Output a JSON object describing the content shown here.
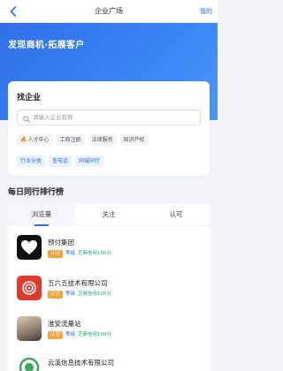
{
  "header": {
    "title": "企业广场",
    "mine_label": "我的"
  },
  "hero": {
    "slogan": "发现商机·拓展客户"
  },
  "find": {
    "title": "找企业",
    "search_placeholder": "请输入企业名称",
    "chips_row1": [
      "人才中心",
      "工商注册",
      "法律服务",
      "知识产权"
    ],
    "chips_row2": [
      "行业分类",
      "查电话",
      "同城同行"
    ]
  },
  "ranking": {
    "title": "每日同行排行榜",
    "tabs": [
      "浏览量",
      "关注",
      "认可"
    ],
    "items": [
      {
        "name": "预付集团",
        "badge_verified": "认证",
        "badge_level": "等级",
        "badge_credit": "芝麻信用100分"
      },
      {
        "name": "五六五技术有限公司",
        "badge_verified": "认证",
        "badge_level": "等级",
        "badge_credit": "芝麻信用100分"
      },
      {
        "name": "淮安流量站",
        "badge_verified": "认证",
        "badge_level": "等级",
        "badge_credit": "芝麻信用100分"
      },
      {
        "name": "云溪信息技术有限公司",
        "badge_verified": "认证",
        "badge_level": "等级",
        "badge_credit": "芝麻信用100分"
      }
    ]
  },
  "colors": {
    "brand_blue": "#2f6fe4",
    "orange": "#f7a23a",
    "green": "#19a974"
  }
}
